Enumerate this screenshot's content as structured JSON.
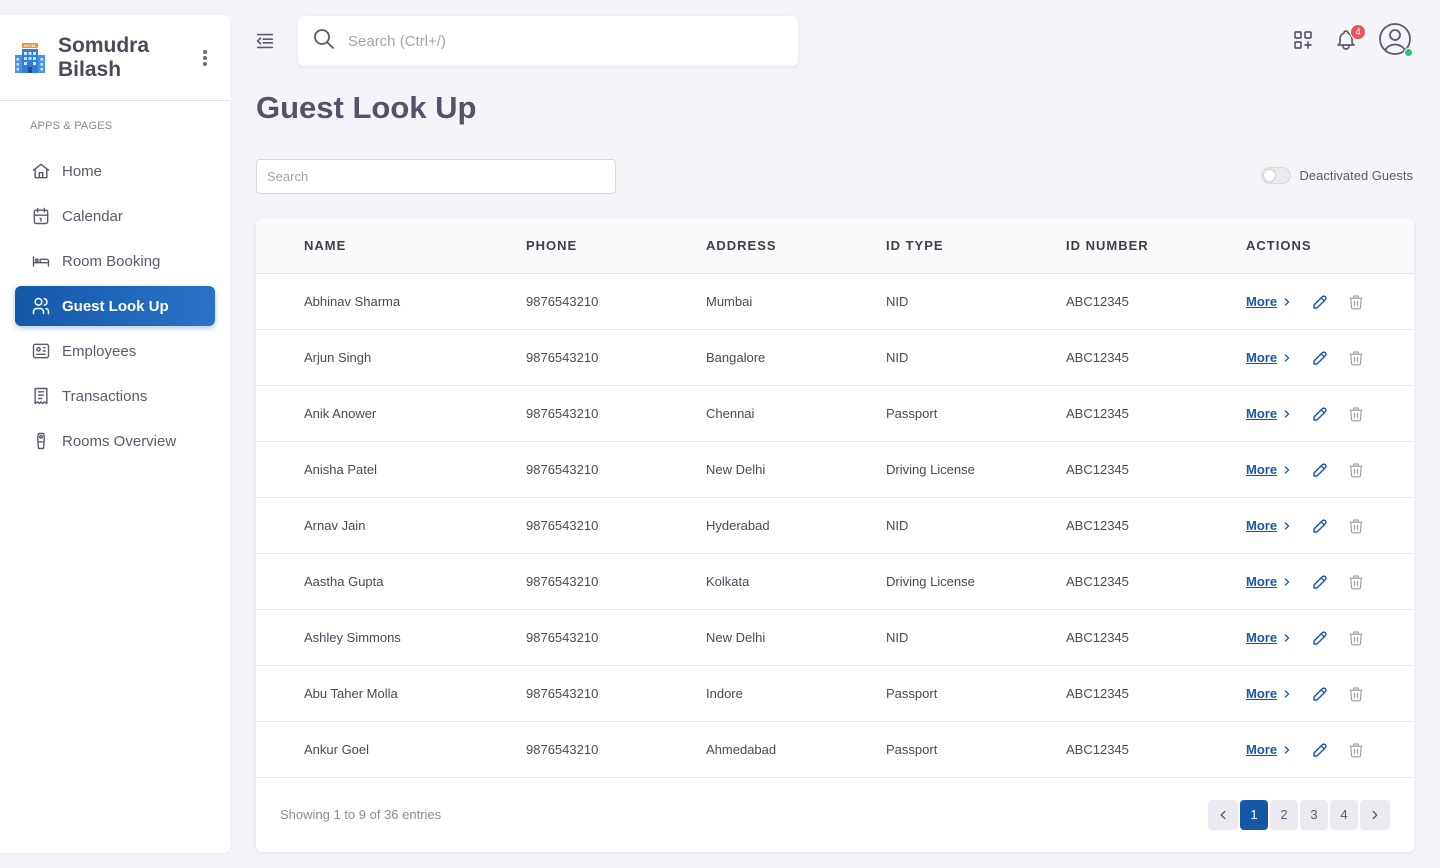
{
  "brand": {
    "line1": "Somudra",
    "line2": "Bilash",
    "logo_text": "HOTEL"
  },
  "sidebar": {
    "section_header": "APPS & PAGES",
    "items": [
      {
        "label": "Home",
        "icon": "home-icon"
      },
      {
        "label": "Calendar",
        "icon": "calendar-icon"
      },
      {
        "label": "Room Booking",
        "icon": "bed-icon"
      },
      {
        "label": "Guest Look Up",
        "icon": "users-icon",
        "active": true
      },
      {
        "label": "Employees",
        "icon": "id-card-icon"
      },
      {
        "label": "Transactions",
        "icon": "receipt-icon"
      },
      {
        "label": "Rooms Overview",
        "icon": "room-tag-icon"
      }
    ]
  },
  "topbar": {
    "search_placeholder": "Search (Ctrl+/)",
    "notification_count": "4"
  },
  "page": {
    "title": "Guest Look Up",
    "filter_placeholder": "Search",
    "toggle_label": "Deactivated Guests"
  },
  "table": {
    "columns": [
      "NAME",
      "PHONE",
      "ADDRESS",
      "ID TYPE",
      "ID NUMBER",
      "ACTIONS"
    ],
    "more_label": "More",
    "rows": [
      {
        "name": "Abhinav Sharma",
        "phone": "9876543210",
        "address": "Mumbai",
        "id_type": "NID",
        "id_number": "ABC12345"
      },
      {
        "name": "Arjun Singh",
        "phone": "9876543210",
        "address": "Bangalore",
        "id_type": "NID",
        "id_number": "ABC12345"
      },
      {
        "name": "Anik Anower",
        "phone": "9876543210",
        "address": "Chennai",
        "id_type": "Passport",
        "id_number": "ABC12345"
      },
      {
        "name": "Anisha Patel",
        "phone": "9876543210",
        "address": "New Delhi",
        "id_type": "Driving License",
        "id_number": "ABC12345"
      },
      {
        "name": "Arnav Jain",
        "phone": "9876543210",
        "address": "Hyderabad",
        "id_type": "NID",
        "id_number": "ABC12345"
      },
      {
        "name": "Aastha Gupta",
        "phone": "9876543210",
        "address": "Kolkata",
        "id_type": "Driving License",
        "id_number": "ABC12345"
      },
      {
        "name": "Ashley Simmons",
        "phone": "9876543210",
        "address": "New Delhi",
        "id_type": "NID",
        "id_number": "ABC12345"
      },
      {
        "name": "Abu Taher Molla",
        "phone": "9876543210",
        "address": "Indore",
        "id_type": "Passport",
        "id_number": "ABC12345"
      },
      {
        "name": "Ankur Goel",
        "phone": "9876543210",
        "address": "Ahmedabad",
        "id_type": "Passport",
        "id_number": "ABC12345"
      }
    ]
  },
  "footer": {
    "showing_text": "Showing 1 to 9 of 36 entries",
    "pages": [
      "1",
      "2",
      "3",
      "4"
    ],
    "current_page": "1"
  },
  "colors": {
    "primary": "#1558a8",
    "badge": "#ea5455",
    "online": "#28c76f"
  }
}
